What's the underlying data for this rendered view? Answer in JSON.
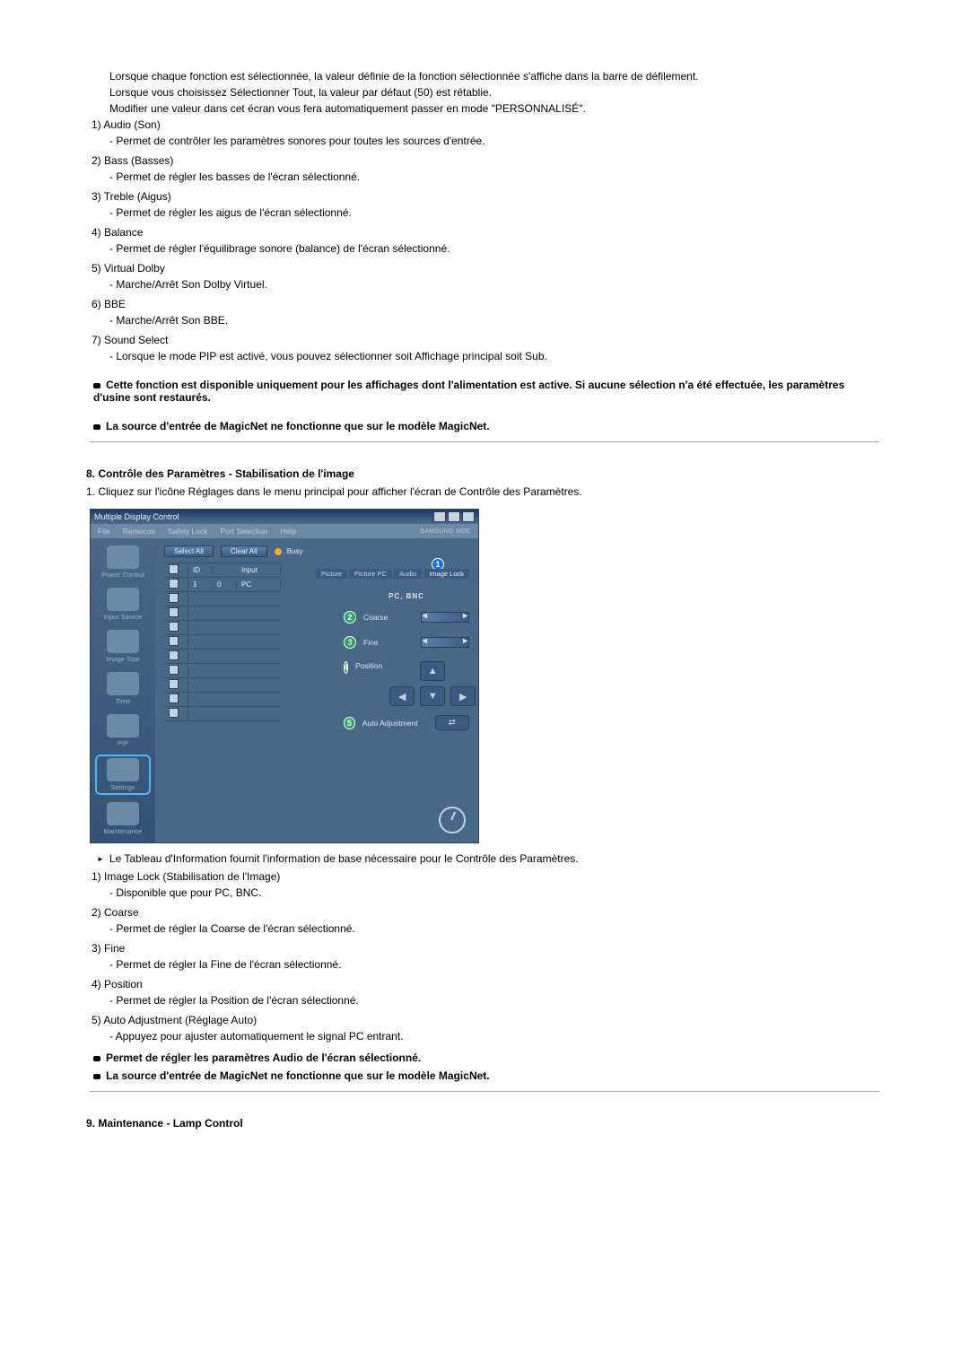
{
  "section1": {
    "intro": [
      "Lorsque chaque fonction est sélectionnée, la valeur définie de la fonction sélectionnée s'affiche dans la barre de défilement.",
      "Lorsque vous choisissez Sélectionner Tout, la valeur par défaut (50) est rétablie.",
      "Modifier une valeur dans cet écran vous fera automatiquement passer en mode \"PERSONNALISÉ\"."
    ],
    "items": [
      {
        "num": "1)",
        "title": "Audio (Son)",
        "desc": "- Permet de contrôler les paramètres sonores pour toutes les sources d'entrée."
      },
      {
        "num": "2)",
        "title": "Bass (Basses)",
        "desc": "- Permet de régler les basses de l'écran sélectionné."
      },
      {
        "num": "3)",
        "title": "Treble (Aigus)",
        "desc": "- Permet de régler les aigus de l'écran sélectionné."
      },
      {
        "num": "4)",
        "title": "Balance",
        "desc": "- Permet de régler l'équilibrage sonore (balance) de l'écran sélectionné."
      },
      {
        "num": "5)",
        "title": "Virtual Dolby",
        "desc": "- Marche/Arrêt Son Dolby Virtuel."
      },
      {
        "num": "6)",
        "title": "BBE",
        "desc": "- Marche/Arrêt Son BBE."
      },
      {
        "num": "7)",
        "title": "Sound Select",
        "desc": "- Lorsque le mode PIP est activé, vous pouvez sélectionner soit Affichage principal soit Sub."
      }
    ],
    "notes": [
      "Cette fonction est disponible uniquement pour les affichages dont l'alimentation est active. Si aucune sélection n'a été effectuée, les paramètres d'usine sont restaurés.",
      "La source d'entrée de MagicNet ne fonctionne que sur le modèle MagicNet."
    ]
  },
  "section2": {
    "title": "8. Contrôle des Paramètres - Stabilisation de l'image",
    "step": "1.  Cliquez sur l'icône Réglages dans le menu principal pour afficher l'écran de Contrôle des Paramètres.",
    "arrow_note": "Le Tableau d'Information fournit l'information de base nécessaire pour le Contrôle des Paramètres.",
    "items": [
      {
        "num": "1)",
        "title": "Image Lock (Stabilisation de l'Image)",
        "desc": "- Disponible que pour PC, BNC."
      },
      {
        "num": "2)",
        "title": "Coarse",
        "desc": "- Permet de régler la Coarse de l'écran sélectionné."
      },
      {
        "num": "3)",
        "title": "Fine",
        "desc": "- Permet de régler la Fine de l'écran sélectionné."
      },
      {
        "num": "4)",
        "title": "Position",
        "desc": "- Permet de régler la Position de l'écran sélectionné."
      },
      {
        "num": "5)",
        "title": "Auto Adjustment (Réglage Auto)",
        "desc": "- Appuyez pour ajuster automatiquement le signal PC entrant."
      }
    ],
    "notes": [
      "Permet de régler les paramètres Audio de l'écran sélectionné.",
      "La source d'entrée de MagicNet ne fonctionne que sur le modèle MagicNet."
    ]
  },
  "section3": {
    "title": "9. Maintenance - Lamp Control"
  },
  "app": {
    "title": "Multiple Display Control",
    "menu": {
      "file": "File",
      "remocon": "Remocon",
      "safety": "Safety Lock",
      "port": "Port Selection",
      "help": "Help",
      "brand": "SAMSUNG MDC"
    },
    "sidebar": {
      "power": "Power Control",
      "input": "Input Source",
      "imgsize": "Image Size",
      "time": "Time",
      "pip": "PIP",
      "settings": "Settings",
      "maint": "Maintenance"
    },
    "buttons": {
      "selectall": "Select All",
      "clearall": "Clear All",
      "busy": "Busy"
    },
    "tabs": {
      "picture": "Picture",
      "picturepc": "Picture PC",
      "audio": "Audio",
      "imagelock": "Image Lock"
    },
    "grid": {
      "id": "ID",
      "input": "Input",
      "col1": "1",
      "col2": "0",
      "col3": "PC"
    },
    "panel": {
      "head": "PC, BNC",
      "coarse": "Coarse",
      "fine": "Fine",
      "position": "Position",
      "auto": "Auto Adjustment"
    },
    "markers": {
      "m1": "1",
      "m2": "2",
      "m3": "3",
      "m4": "4",
      "m5": "5"
    }
  }
}
